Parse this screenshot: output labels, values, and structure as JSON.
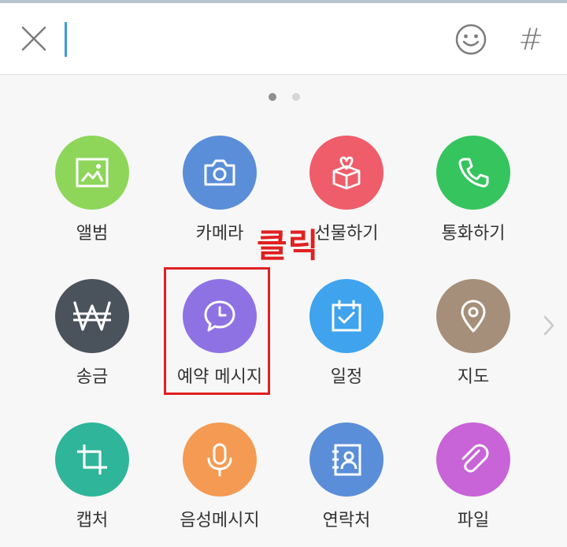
{
  "input_bar": {
    "close_icon": "close-icon",
    "emoji_icon": "smiley-icon",
    "hash_label": "#",
    "accent_color": "#3a9bd6"
  },
  "pager": {
    "total_pages": 2,
    "current_page": 1
  },
  "grid": {
    "items": [
      {
        "label": "앨범",
        "icon": "album-icon",
        "color": "#8dd65a"
      },
      {
        "label": "카메라",
        "icon": "camera-icon",
        "color": "#5a8ed9"
      },
      {
        "label": "선물하기",
        "icon": "gift-icon",
        "color": "#ef5d6a"
      },
      {
        "label": "통화하기",
        "icon": "phone-icon",
        "color": "#36c45e"
      },
      {
        "label": "송금",
        "icon": "won-icon",
        "color": "#4a525b"
      },
      {
        "label": "예약 메시지",
        "icon": "clock-message-icon",
        "color": "#8e72e4"
      },
      {
        "label": "일정",
        "icon": "calendar-icon",
        "color": "#3fa3ee"
      },
      {
        "label": "지도",
        "icon": "map-pin-icon",
        "color": "#a68f7a"
      },
      {
        "label": "캡처",
        "icon": "crop-icon",
        "color": "#2fb59a"
      },
      {
        "label": "음성메시지",
        "icon": "microphone-icon",
        "color": "#f59a52"
      },
      {
        "label": "연락처",
        "icon": "contact-icon",
        "color": "#5a8ed9"
      },
      {
        "label": "파일",
        "icon": "paperclip-icon",
        "color": "#c863d8"
      }
    ]
  },
  "annotation": {
    "text": "클릭",
    "color": "#e02020"
  }
}
